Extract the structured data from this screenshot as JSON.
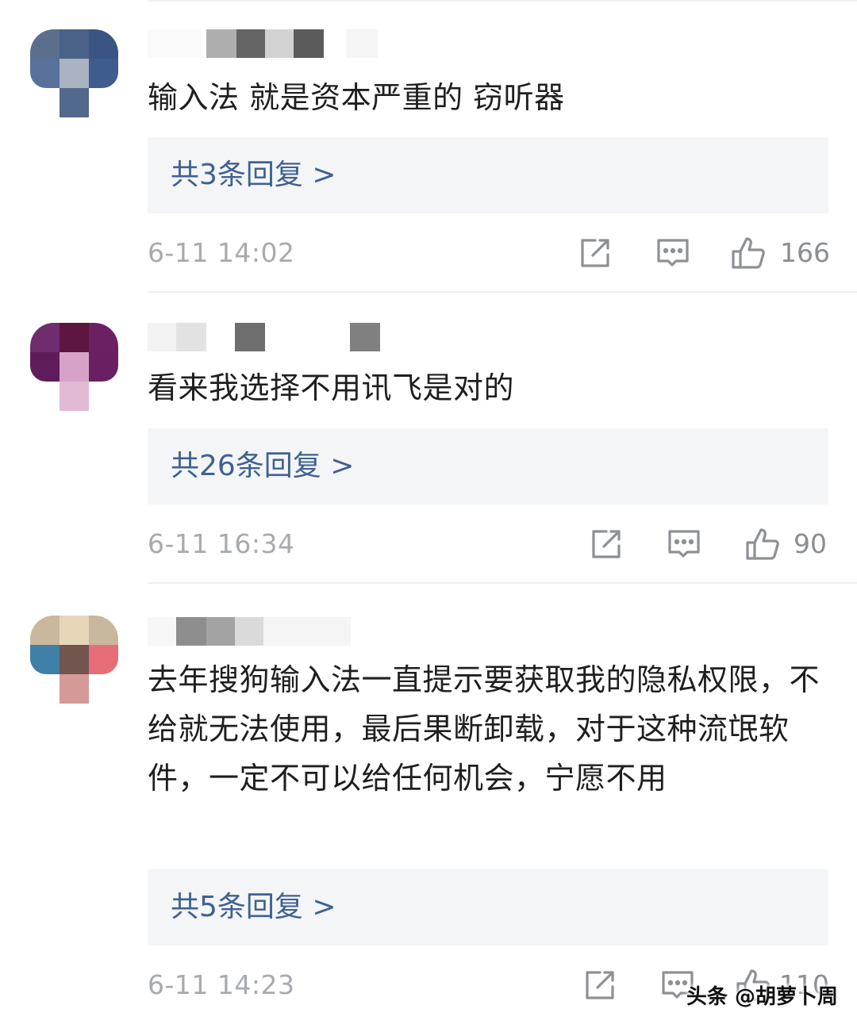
{
  "comments": [
    {
      "text": "输入法 就是资本严重的 窃听器",
      "reply": "共3条回复 >",
      "time": "6-11 14:02",
      "likes": "166"
    },
    {
      "text": "看来我选择不用讯飞是对的",
      "reply": "共26条回复 >",
      "time": "6-11 16:34",
      "likes": "90"
    },
    {
      "text": "去年搜狗输入法一直提示要获取我的隐私权限，不给就无法使用，最后果断卸载，对于这种流氓软件，一定不可以给任何机会，宁愿不用",
      "reply": "共5条回复 >",
      "time": "6-11 14:23",
      "likes": "110"
    }
  ],
  "icons": {
    "share": "share-icon",
    "comment": "comment-icon",
    "like": "thumbs-up-icon"
  },
  "colors": {
    "reply_link": "#3f6191",
    "meta_gray": "#a7aaae",
    "reply_bg": "#f4f5f7"
  },
  "watermark": "头条 @胡萝卜周"
}
